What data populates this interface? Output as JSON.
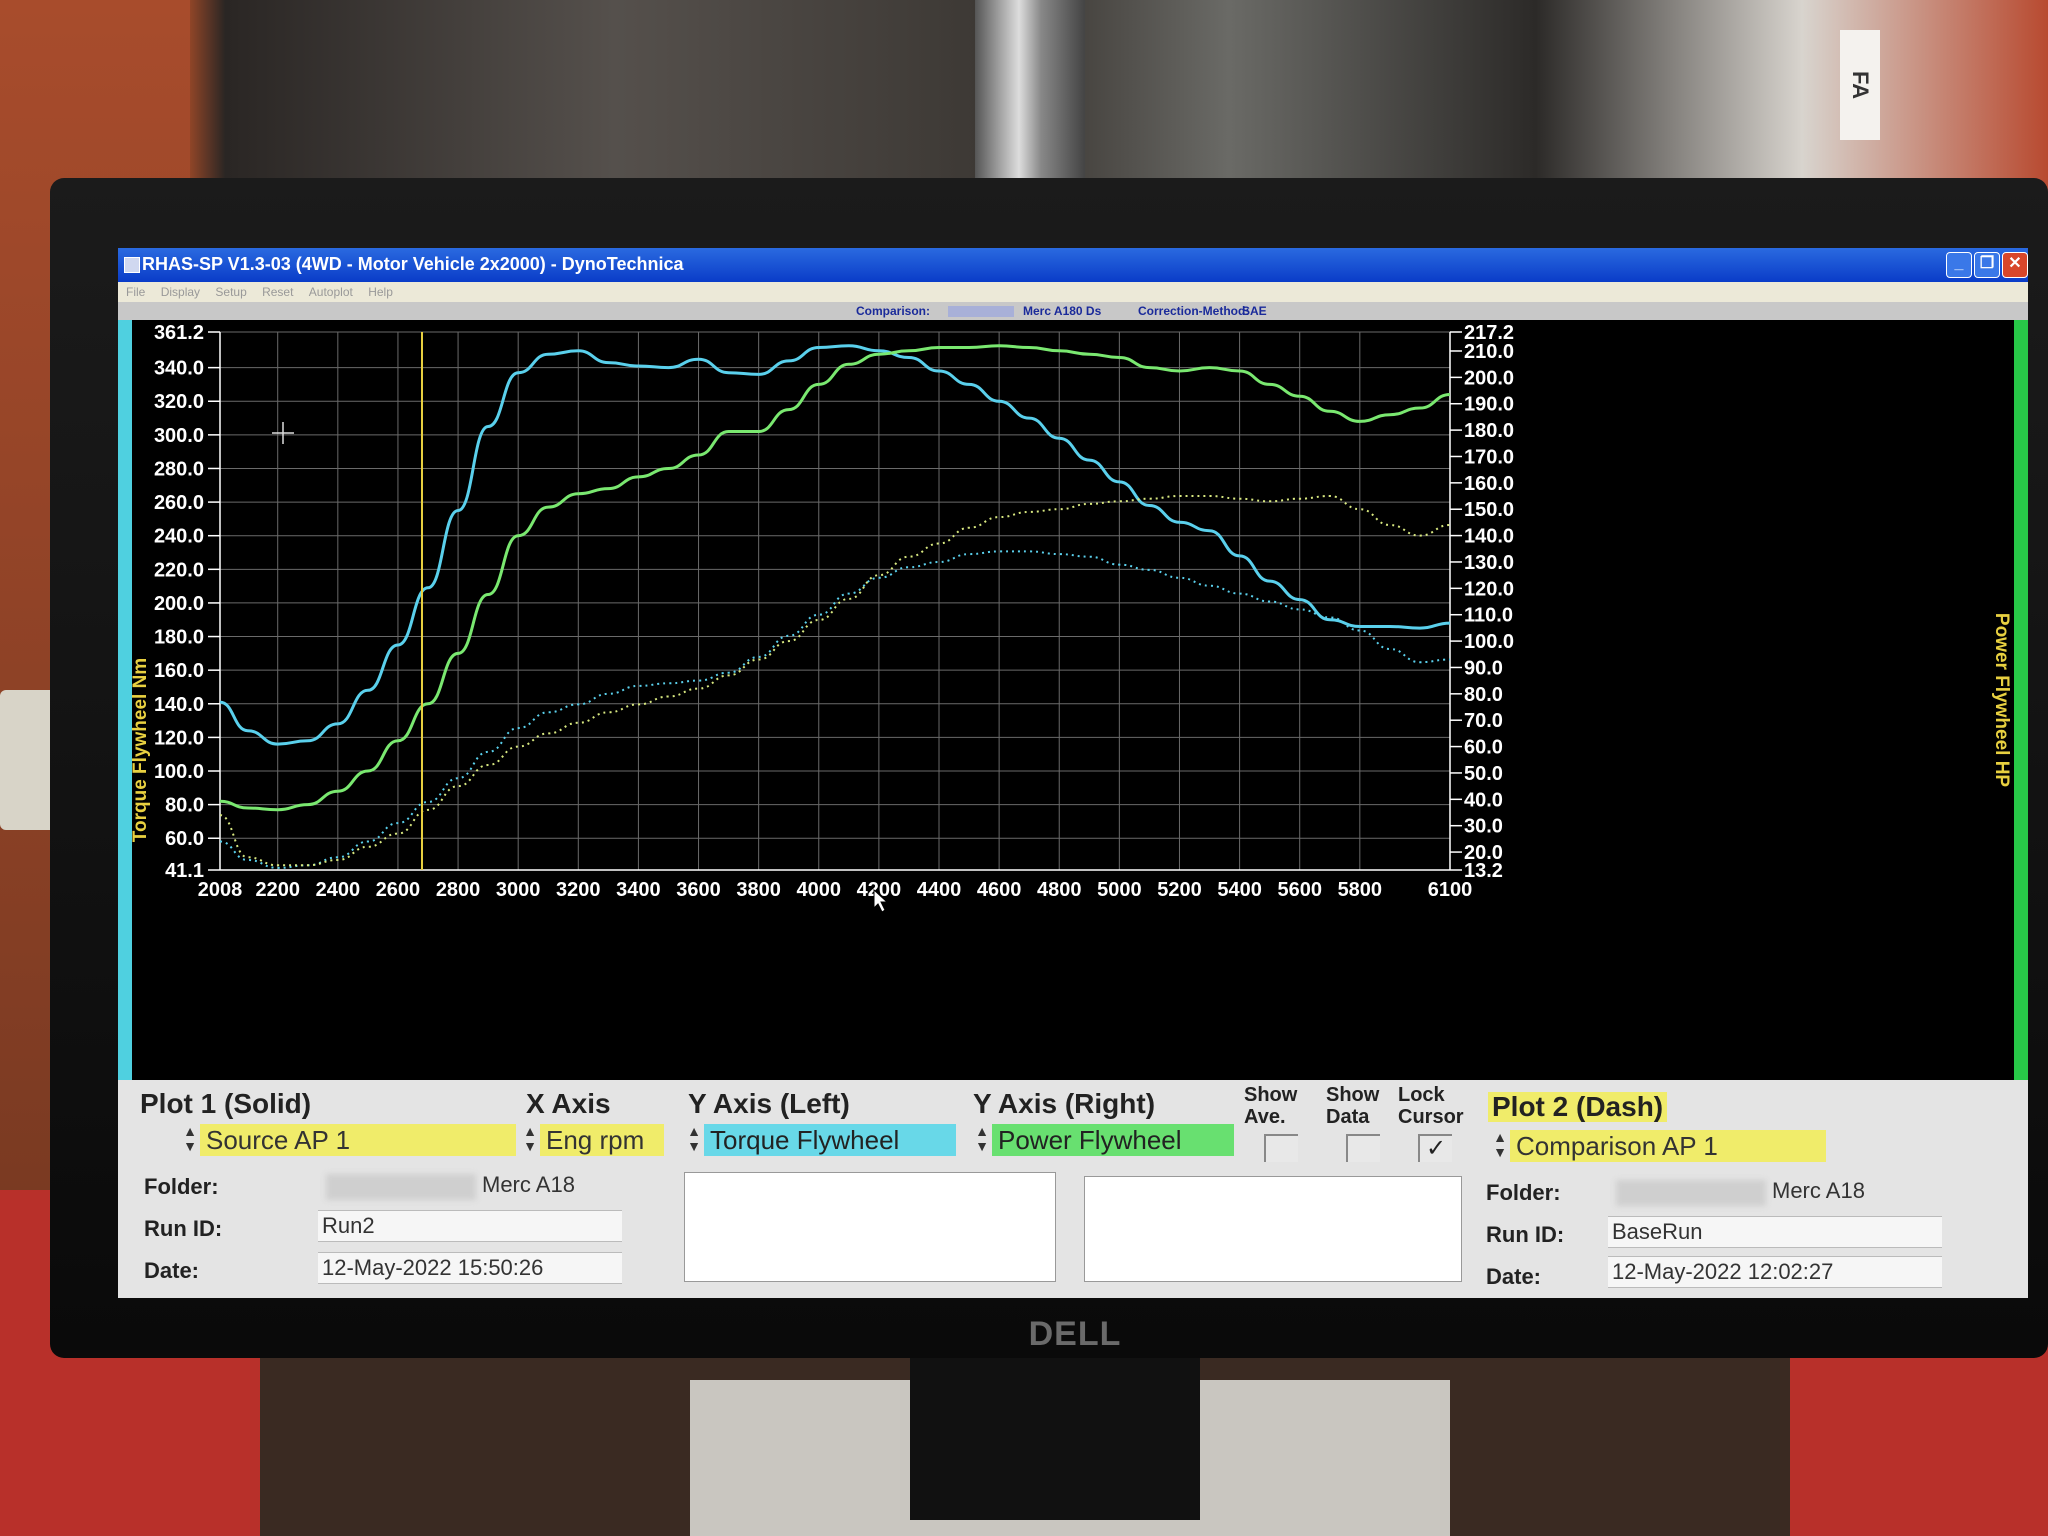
{
  "window": {
    "title": "RHAS-SP V1.3-03  (4WD - Motor Vehicle 2x2000) - DynoTechnica"
  },
  "menu": [
    "File",
    "Display",
    "Setup",
    "Reset",
    "Autoplot",
    "Help"
  ],
  "comparison_strip": {
    "comparison_label": "Comparison:",
    "comparison_name": "Merc A180 Ds",
    "correction_label": "Correction-Method:",
    "correction_value": "SAE"
  },
  "chart_data": {
    "type": "line",
    "xlabel": "",
    "ylabel_left": "Torque Flywheel Nm",
    "ylabel_right": "Power Flywheel HP",
    "xlim": [
      2008,
      6100
    ],
    "ylim_left": [
      41.1,
      361.2
    ],
    "ylim_right": [
      13.2,
      217.2
    ],
    "x_tick_labels": [
      "2008",
      "2200",
      "2400",
      "2600",
      "2800",
      "3000",
      "3200",
      "3400",
      "3600",
      "3800",
      "4000",
      "4200",
      "4400",
      "4600",
      "4800",
      "5000",
      "5200",
      "5400",
      "5600",
      "5800",
      "6100"
    ],
    "y_left_tick_labels": [
      "361.2",
      "340.0",
      "320.0",
      "300.0",
      "280.0",
      "260.0",
      "240.0",
      "220.0",
      "200.0",
      "180.0",
      "160.0",
      "140.0",
      "120.0",
      "100.0",
      "80.0",
      "60.0",
      "41.1"
    ],
    "y_right_tick_labels": [
      "217.2",
      "210.0",
      "200.0",
      "190.0",
      "180.0",
      "170.0",
      "160.0",
      "150.0",
      "140.0",
      "130.0",
      "120.0",
      "110.0",
      "100.0",
      "90.0",
      "80.0",
      "70.0",
      "60.0",
      "50.0",
      "40.0",
      "30.0",
      "20.0",
      "13.2"
    ],
    "grid": true,
    "cursor_x": 2680,
    "series": [
      {
        "axis": "left",
        "style": "solid",
        "color": "#5ad0ec",
        "x": [
          2008,
          2100,
          2200,
          2300,
          2400,
          2500,
          2600,
          2700,
          2800,
          2900,
          3000,
          3100,
          3200,
          3300,
          3400,
          3500,
          3600,
          3700,
          3800,
          3900,
          4000,
          4100,
          4200,
          4300,
          4400,
          4500,
          4600,
          4700,
          4800,
          4900,
          5000,
          5100,
          5200,
          5300,
          5400,
          5500,
          5600,
          5700,
          5800,
          5900,
          6000,
          6100
        ],
        "values": [
          141,
          124,
          116,
          118,
          128,
          148,
          175,
          209,
          255,
          305,
          337,
          348,
          350,
          343,
          341,
          340,
          345,
          337,
          336,
          344,
          352,
          353,
          350,
          346,
          338,
          330,
          320,
          310,
          298,
          285,
          272,
          258,
          248,
          243,
          228,
          213,
          202,
          190,
          186,
          186,
          185,
          188
        ]
      },
      {
        "axis": "left",
        "style": "solid",
        "color": "#7ae870",
        "x": [
          2008,
          2100,
          2200,
          2300,
          2400,
          2500,
          2600,
          2700,
          2800,
          2900,
          3000,
          3100,
          3200,
          3300,
          3400,
          3500,
          3600,
          3700,
          3800,
          3900,
          4000,
          4100,
          4200,
          4300,
          4400,
          4500,
          4600,
          4700,
          4800,
          4900,
          5000,
          5100,
          5200,
          5300,
          5400,
          5500,
          5600,
          5700,
          5800,
          5900,
          6000,
          6100
        ],
        "values": [
          82,
          78,
          77,
          80,
          88,
          100,
          118,
          140,
          170,
          205,
          240,
          257,
          265,
          268,
          275,
          280,
          288,
          302,
          302,
          315,
          330,
          342,
          348,
          350,
          352,
          352,
          353,
          352,
          350,
          348,
          346,
          340,
          338,
          340,
          338,
          330,
          323,
          314,
          308,
          312,
          316,
          324
        ]
      },
      {
        "axis": "right",
        "style": "dash",
        "color": "#5ad0ec",
        "x": [
          2008,
          2100,
          2200,
          2300,
          2400,
          2500,
          2600,
          2700,
          2800,
          2900,
          3000,
          3100,
          3200,
          3300,
          3400,
          3500,
          3600,
          3700,
          3800,
          3900,
          4000,
          4100,
          4200,
          4300,
          4400,
          4500,
          4600,
          4700,
          4800,
          4900,
          5000,
          5100,
          5200,
          5300,
          5400,
          5500,
          5600,
          5700,
          5800,
          5900,
          6000,
          6100
        ],
        "values": [
          24,
          17,
          14,
          15,
          18,
          24,
          31,
          39,
          48,
          58,
          67,
          73,
          76,
          80,
          83,
          84,
          85,
          88,
          94,
          102,
          110,
          118,
          124,
          128,
          130,
          133,
          134,
          134,
          133,
          132,
          129,
          127,
          124,
          121,
          118,
          115,
          112,
          109,
          104,
          97,
          92,
          93
        ]
      },
      {
        "axis": "right",
        "style": "dash",
        "color": "#d8e880",
        "x": [
          2008,
          2100,
          2200,
          2300,
          2400,
          2500,
          2600,
          2700,
          2800,
          2900,
          3000,
          3100,
          3200,
          3300,
          3400,
          3500,
          3600,
          3700,
          3800,
          3900,
          4000,
          4100,
          4200,
          4300,
          4400,
          4500,
          4600,
          4700,
          4800,
          4900,
          5000,
          5100,
          5200,
          5300,
          5400,
          5500,
          5600,
          5700,
          5800,
          5900,
          6000,
          6100
        ],
        "values": [
          34,
          18,
          15,
          15,
          17,
          22,
          27,
          36,
          45,
          53,
          60,
          65,
          69,
          73,
          76,
          79,
          82,
          87,
          93,
          100,
          108,
          116,
          125,
          132,
          137,
          143,
          147,
          149,
          150,
          152,
          153,
          154,
          155,
          155,
          154,
          153,
          154,
          155,
          150,
          144,
          140,
          144
        ]
      }
    ]
  },
  "panel": {
    "plot1_header": "Plot 1 (Solid)",
    "xaxis_header": "X Axis",
    "yleft_header": "Y Axis (Left)",
    "yright_header": "Y Axis (Right)",
    "show_ave_label": "Show Ave.",
    "show_data_label": "Show Data",
    "lock_cursor_label": "Lock Cursor",
    "plot2_header": "Plot 2 (Dash)",
    "plot1_source": "Source AP 1",
    "xaxis_value": "Eng rpm",
    "yleft_value": "Torque Flywheel",
    "yright_value": "Power Flywheel",
    "plot2_source": "Comparison AP 1",
    "show_ave_checked": "",
    "show_data_checked": "",
    "lock_cursor_checked": "✓",
    "folder_label": "Folder:",
    "runid_label": "Run ID:",
    "date_label": "Date:",
    "plot1": {
      "folder": "Merc A18",
      "run_id": "Run2",
      "date": "12-May-2022   15:50:26"
    },
    "plot2": {
      "folder": "Merc A18",
      "run_id": "BaseRun",
      "date": "12-May-2022   12:02:27"
    }
  },
  "colors": {
    "title_bar": "#0a3cc8",
    "plot_background": "#000000",
    "grid": "#6a6a6a",
    "yellow_field": "#f0ec6a",
    "cyan_field": "#68d8e8",
    "green_field": "#68e070",
    "cursor_line": "#e8d040"
  },
  "monitor": {
    "brand": "DELL"
  },
  "wall_sign": {
    "text": "FA"
  }
}
